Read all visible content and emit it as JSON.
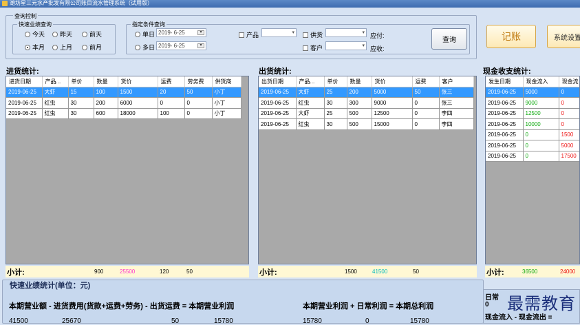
{
  "window": {
    "title": "潍坊星三元水产批发有限公司账目流水管理系统（试用版）"
  },
  "query": {
    "group_title": "查询控制",
    "quick_title": "快速业绩查询",
    "radios": [
      "今天",
      "昨天",
      "前天",
      "本月",
      "上月",
      "前月"
    ],
    "selected_radio": "本月",
    "cond_title": "指定条件查询",
    "single_day_label": "单日",
    "single_day_value": "2019- 6-25",
    "multi_day_label": "多日",
    "multi_day_value": "2019- 6-25",
    "product_label": "产品",
    "supplier_label": "供货",
    "customer_label": "客户",
    "payable_label": "应付:",
    "receivable_label": "应收:",
    "query_button": "查询"
  },
  "toolbar": {
    "bookkeeping_button": "记账",
    "settings_button": "系统设置"
  },
  "purchase": {
    "title": "进货统计:",
    "columns": [
      "进货日期",
      "产品...",
      "单价",
      "数量",
      "货价",
      "运费",
      "劳务费",
      "供货商"
    ],
    "rows": [
      [
        "2019-06-25",
        "大虾",
        "15",
        "100",
        "1500",
        "20",
        "50",
        "小丁"
      ],
      [
        "2019-06-25",
        "红虫",
        "30",
        "200",
        "6000",
        "0",
        "0",
        "小丁"
      ],
      [
        "2019-06-25",
        "红虫",
        "30",
        "600",
        "18000",
        "100",
        "0",
        "小丁"
      ]
    ],
    "subtotal_label": "小计:",
    "subtotal_qty": "900",
    "subtotal_price": "25500",
    "subtotal_freight": "120",
    "subtotal_labor": "50"
  },
  "sales": {
    "title": "出货统计:",
    "columns": [
      "出货日期",
      "产品...",
      "单价",
      "数量",
      "货价",
      "运费",
      "客户"
    ],
    "rows": [
      [
        "2019-06-25",
        "大虾",
        "25",
        "200",
        "5000",
        "50",
        "张三"
      ],
      [
        "2019-06-25",
        "红虫",
        "30",
        "300",
        "9000",
        "0",
        "张三"
      ],
      [
        "2019-06-25",
        "大虾",
        "25",
        "500",
        "12500",
        "0",
        "李四"
      ],
      [
        "2019-06-25",
        "红虫",
        "30",
        "500",
        "15000",
        "0",
        "李四"
      ]
    ],
    "subtotal_label": "小计:",
    "subtotal_qty": "1500",
    "subtotal_price": "41500",
    "subtotal_freight": "50"
  },
  "cash": {
    "title": "现金收支统计:",
    "columns": [
      "发生日期",
      "现金流入",
      "现金流"
    ],
    "rows": [
      [
        "2019-06-25",
        "5000",
        "0"
      ],
      [
        "2019-06-25",
        "9000",
        "0"
      ],
      [
        "2019-06-25",
        "12500",
        "0"
      ],
      [
        "2019-06-25",
        "10000",
        "0"
      ],
      [
        "2019-06-25",
        "0",
        "1500"
      ],
      [
        "2019-06-25",
        "0",
        "5000"
      ],
      [
        "2019-06-25",
        "0",
        "17500"
      ]
    ],
    "subtotal_label": "小计:",
    "subtotal_in": "36500",
    "subtotal_out": "24000"
  },
  "summary": {
    "title": "快速业绩统计(单位：元)",
    "formula1": "本期营业额 - 进货费用(货款+运费+劳务) - 出货运费 = 本期营业利润",
    "formula2": "本期营业利润  + 日常利润 = 本期总利润",
    "v_revenue": "41500",
    "v_purchase": "25670",
    "v_freight": "50",
    "v_profit": "15780",
    "v_profit2": "15780",
    "v_daily": "0",
    "v_total": "15780",
    "right_line1": "日常",
    "right_line1_value": "0",
    "right_line2": "现金流入 - 现金流出 ="
  },
  "watermark": "最需教育",
  "colors": {
    "selection": "#3399ff",
    "inflow": "#11aa11",
    "outflow": "#ee1111",
    "subtotal_bg": "#fff8d4",
    "pink_value": "#ff33cc",
    "cyan_value": "#00bbbb"
  }
}
